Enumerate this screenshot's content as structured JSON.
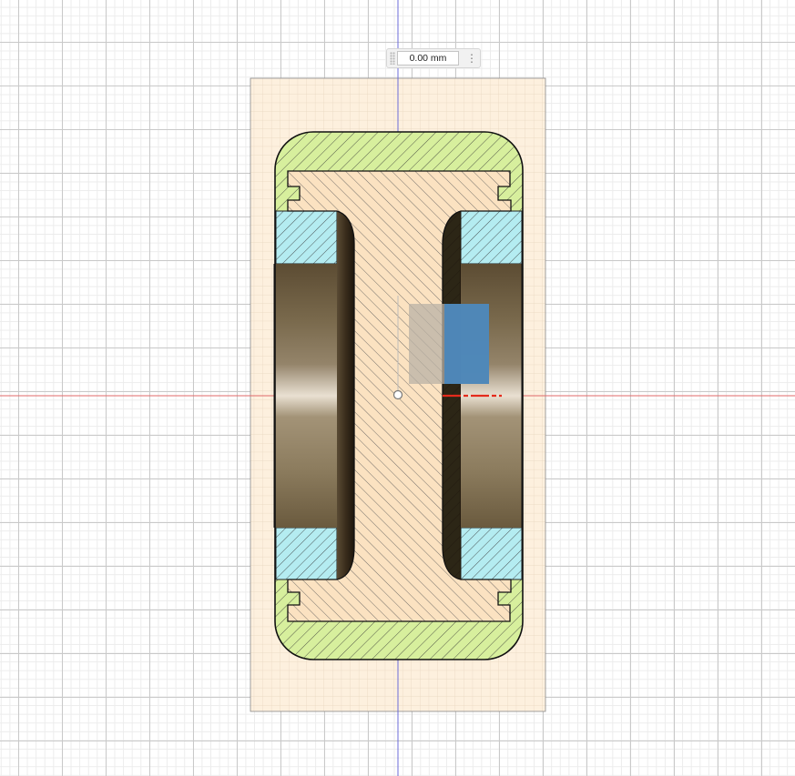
{
  "viewport": {
    "grid": "on",
    "sketch_profile_fill": "#fdf0de",
    "part_fill": "#fbe2c1",
    "outer_ring_fill": "#d7ef9d",
    "bearing_fill": "#b4ecf1",
    "cut_face_shading": "#5a4a34",
    "selection_fill": "#4a86b9",
    "axis_x_color": "#e06a6a",
    "axis_y_color": "#6b6bd8"
  },
  "dimension_input": {
    "value": "0.00 mm",
    "menu_icon": "vertical-ellipsis-icon"
  }
}
